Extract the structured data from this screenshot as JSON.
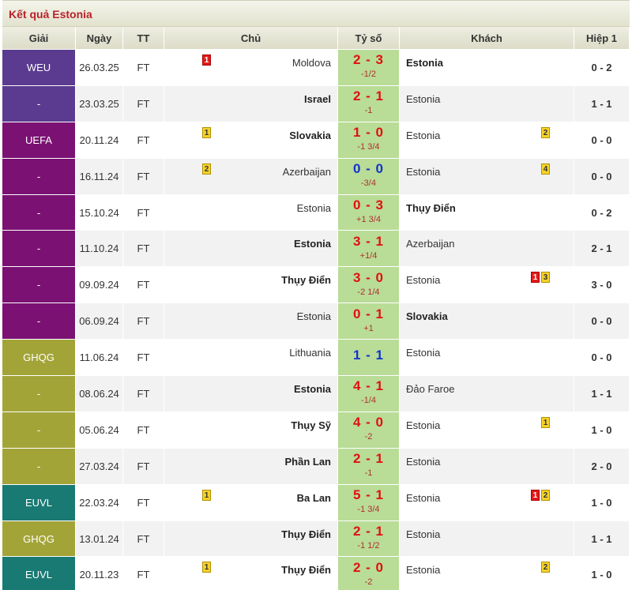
{
  "title": "Kết quả Estonia",
  "headers": {
    "league": "Giải",
    "date": "Ngày",
    "status": "TT",
    "home": "Chủ",
    "score": "Tỷ số",
    "away": "Khách",
    "half": "Hiệp 1"
  },
  "league_colors": {
    "WEU": "#5b3b8f",
    "UEFA": "#7b1273",
    "GHQG": "#a3a438",
    "EUVL": "#197a73"
  },
  "rows": [
    {
      "league": "WEU",
      "league_color": "#5b3b8f",
      "date": "26.03.25",
      "status": "FT",
      "home": "Moldova",
      "home_bold": false,
      "home_cards": [
        {
          "type": "red",
          "n": "1"
        }
      ],
      "score": "2 - 3",
      "draw": false,
      "handicap": "-1/2",
      "away": "Estonia",
      "away_bold": true,
      "away_cards": [],
      "half": "0 - 2"
    },
    {
      "league": "-",
      "league_color": "#5b3b8f",
      "date": "23.03.25",
      "status": "FT",
      "home": "Israel",
      "home_bold": true,
      "home_cards": [],
      "score": "2 - 1",
      "draw": false,
      "handicap": "-1",
      "away": "Estonia",
      "away_bold": false,
      "away_cards": [],
      "half": "1 - 1"
    },
    {
      "league": "UEFA",
      "league_color": "#7b1273",
      "date": "20.11.24",
      "status": "FT",
      "home": "Slovakia",
      "home_bold": true,
      "home_cards": [
        {
          "type": "yellow",
          "n": "1"
        }
      ],
      "score": "1 - 0",
      "draw": false,
      "handicap": "-1 3/4",
      "away": "Estonia",
      "away_bold": false,
      "away_cards": [
        {
          "type": "yellow",
          "n": "2"
        }
      ],
      "half": "0 - 0"
    },
    {
      "league": "-",
      "league_color": "#7b1273",
      "date": "16.11.24",
      "status": "FT",
      "home": "Azerbaijan",
      "home_bold": false,
      "home_cards": [
        {
          "type": "yellow",
          "n": "2"
        }
      ],
      "score": "0 - 0",
      "draw": true,
      "handicap": "-3/4",
      "away": "Estonia",
      "away_bold": false,
      "away_cards": [
        {
          "type": "yellow",
          "n": "4"
        }
      ],
      "half": "0 - 0"
    },
    {
      "league": "-",
      "league_color": "#7b1273",
      "date": "15.10.24",
      "status": "FT",
      "home": "Estonia",
      "home_bold": false,
      "home_cards": [],
      "score": "0 - 3",
      "draw": false,
      "handicap": "+1 3/4",
      "away": "Thụy Điển",
      "away_bold": true,
      "away_cards": [],
      "half": "0 - 2"
    },
    {
      "league": "-",
      "league_color": "#7b1273",
      "date": "11.10.24",
      "status": "FT",
      "home": "Estonia",
      "home_bold": true,
      "home_cards": [],
      "score": "3 - 1",
      "draw": false,
      "handicap": "+1/4",
      "away": "Azerbaijan",
      "away_bold": false,
      "away_cards": [],
      "half": "2 - 1"
    },
    {
      "league": "-",
      "league_color": "#7b1273",
      "date": "09.09.24",
      "status": "FT",
      "home": "Thụy Điển",
      "home_bold": true,
      "home_cards": [],
      "score": "3 - 0",
      "draw": false,
      "handicap": "-2 1/4",
      "away": "Estonia",
      "away_bold": false,
      "away_cards": [
        {
          "type": "red",
          "n": "1"
        },
        {
          "type": "yellow",
          "n": "3"
        }
      ],
      "half": "3 - 0"
    },
    {
      "league": "-",
      "league_color": "#7b1273",
      "date": "06.09.24",
      "status": "FT",
      "home": "Estonia",
      "home_bold": false,
      "home_cards": [],
      "score": "0 - 1",
      "draw": false,
      "handicap": "+1",
      "away": "Slovakia",
      "away_bold": true,
      "away_cards": [],
      "half": "0 - 0"
    },
    {
      "league": "GHQG",
      "league_color": "#a3a438",
      "date": "11.06.24",
      "status": "FT",
      "home": "Lithuania",
      "home_bold": false,
      "home_cards": [],
      "score": "1 - 1",
      "draw": true,
      "handicap": "",
      "away": "Estonia",
      "away_bold": false,
      "away_cards": [],
      "half": "0 - 0"
    },
    {
      "league": "-",
      "league_color": "#a3a438",
      "date": "08.06.24",
      "status": "FT",
      "home": "Estonia",
      "home_bold": true,
      "home_cards": [],
      "score": "4 - 1",
      "draw": false,
      "handicap": "-1/4",
      "away": "Đảo Faroe",
      "away_bold": false,
      "away_cards": [],
      "half": "1 - 1"
    },
    {
      "league": "-",
      "league_color": "#a3a438",
      "date": "05.06.24",
      "status": "FT",
      "home": "Thụy Sỹ",
      "home_bold": true,
      "home_cards": [],
      "score": "4 - 0",
      "draw": false,
      "handicap": "-2",
      "away": "Estonia",
      "away_bold": false,
      "away_cards": [
        {
          "type": "yellow",
          "n": "1"
        }
      ],
      "half": "1 - 0"
    },
    {
      "league": "-",
      "league_color": "#a3a438",
      "date": "27.03.24",
      "status": "FT",
      "home": "Phần Lan",
      "home_bold": true,
      "home_cards": [],
      "score": "2 - 1",
      "draw": false,
      "handicap": "-1",
      "away": "Estonia",
      "away_bold": false,
      "away_cards": [],
      "half": "2 - 0"
    },
    {
      "league": "EUVL",
      "league_color": "#197a73",
      "date": "22.03.24",
      "status": "FT",
      "home": "Ba Lan",
      "home_bold": true,
      "home_cards": [
        {
          "type": "yellow",
          "n": "1"
        }
      ],
      "score": "5 - 1",
      "draw": false,
      "handicap": "-1 3/4",
      "away": "Estonia",
      "away_bold": false,
      "away_cards": [
        {
          "type": "red",
          "n": "1"
        },
        {
          "type": "yellow",
          "n": "2"
        }
      ],
      "half": "1 - 0"
    },
    {
      "league": "GHQG",
      "league_color": "#a3a438",
      "date": "13.01.24",
      "status": "FT",
      "home": "Thụy Điển",
      "home_bold": true,
      "home_cards": [],
      "score": "2 - 1",
      "draw": false,
      "handicap": "-1 1/2",
      "away": "Estonia",
      "away_bold": false,
      "away_cards": [],
      "half": "1 - 1"
    },
    {
      "league": "EUVL",
      "league_color": "#197a73",
      "date": "20.11.23",
      "status": "FT",
      "home": "Thụy Điển",
      "home_bold": true,
      "home_cards": [
        {
          "type": "yellow",
          "n": "1"
        }
      ],
      "score": "2 - 0",
      "draw": false,
      "handicap": "-2",
      "away": "Estonia",
      "away_bold": false,
      "away_cards": [
        {
          "type": "yellow",
          "n": "2"
        }
      ],
      "half": "1 - 0"
    }
  ]
}
